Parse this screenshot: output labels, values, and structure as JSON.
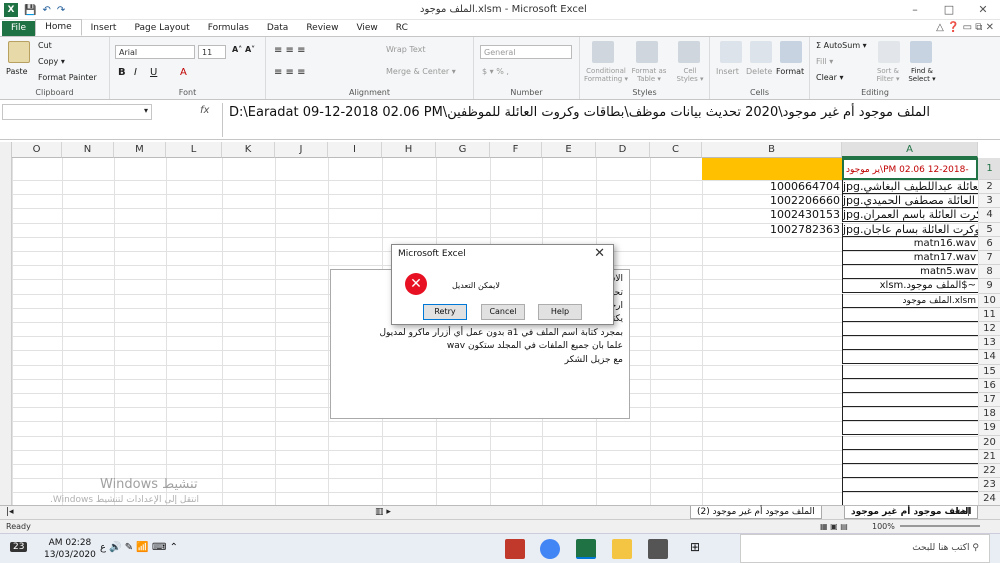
{
  "window": {
    "title": "الملف موجود.xlsm - Microsoft Excel",
    "controls": [
      "–",
      "□",
      "✕"
    ]
  },
  "tabs": [
    "File",
    "Home",
    "Insert",
    "Page Layout",
    "Formulas",
    "Data",
    "Review",
    "View",
    "RC"
  ],
  "ribbon": {
    "clipboard": {
      "paste": "Paste",
      "cut": "Cut",
      "copy": "Copy ▾",
      "format_painter": "Format Painter",
      "label": "Clipboard"
    },
    "font": {
      "name": "Arial",
      "size": "11",
      "label": "Font",
      "bold": "B",
      "italic": "I",
      "underline": "U"
    },
    "alignment": {
      "wrap": "Wrap Text",
      "merge": "Merge & Center ▾",
      "label": "Alignment"
    },
    "number": {
      "format": "General",
      "label": "Number"
    },
    "styles": {
      "conditional": "Conditional Formatting ▾",
      "format_table": "Format as Table ▾",
      "cell_styles": "Cell Styles ▾",
      "label": "Styles"
    },
    "cells": {
      "insert": "Insert",
      "delete": "Delete",
      "format": "Format",
      "label": "Cells"
    },
    "editing": {
      "autosum": "Σ AutoSum ▾",
      "fill": "Fill ▾",
      "clear": "Clear ▾",
      "sort": "Sort & Filter ▾",
      "find": "Find & Select ▾",
      "label": "Editing"
    }
  },
  "formula_bar": {
    "fx": "fx",
    "content": "D:\\Earadat 09-12-2018   02.06 PM\\الملف موجود أم غير موجود\\2020 تحديث بيانات موظف\\بطاقات وكروت العائلة للموظفين"
  },
  "columns": [
    "O",
    "N",
    "M",
    "L",
    "K",
    "J",
    "I",
    "H",
    "G",
    "F",
    "E",
    "D",
    "C",
    "B",
    "A"
  ],
  "rows": [
    "1",
    "2",
    "3",
    "4",
    "5",
    "6",
    "7",
    "8",
    "9",
    "10",
    "11",
    "12",
    "13",
    "14",
    "15",
    "16",
    "17",
    "18",
    "19",
    "20",
    "21",
    "22",
    "23",
    "24"
  ],
  "cells": {
    "A1": "ير موجود\\PM 02.06   12-2018-",
    "A": [
      "jpg.بطاقة الاحوال وكرت العائلة عبداللطيف البغاشي",
      "jpg.بطاقة الاحوال وكرت العائلة مصطفى الحميدي",
      "jpg.بطاقة الاحوال وكرت العائلة باسم العمران",
      "jpg.بطاقة الاحوال وكرت العائلة بسام عاجان",
      "matn16.wav",
      "matn17.wav",
      "matn5.wav",
      "xlsm.الملف موجود$~",
      "الملف موجود.xlsm"
    ],
    "B": [
      "1000664704",
      "1002206660",
      "1002430153",
      "1002782363"
    ]
  },
  "textbox": [
    "الاستاذ",
    "تحية",
    "ارجو",
    "يكتب",
    "بمجرد كتابة اسم الملف في a1  بدون عمل أي أزرار ماكرو لمديول",
    "علما بان جميع الملفات في المجلد ستكون wav",
    "مع جزيل الشكر"
  ],
  "dialog": {
    "title": "Microsoft Excel",
    "close": "✕",
    "message": "لايمكن التعديل",
    "buttons": [
      "Retry",
      "Cancel",
      "Help"
    ]
  },
  "sheets": [
    "الملف موجود أم غير موجود",
    "الملف موجود أم غير موجود (2)"
  ],
  "status": {
    "ready": "Ready",
    "zoom": "100%"
  },
  "watermark": {
    "line1": "Windows تنشيط",
    "line2": "انتقل إلى الإعدادات لتنشيط Windows."
  },
  "taskbar": {
    "time": "AM 02:28",
    "date": "13/03/2020",
    "search": "اكتب هنا للبحث",
    "badge": "23"
  },
  "colors": {
    "excel_green": "#1f7244",
    "orange": "#ffc000",
    "error_red": "#e81123"
  }
}
